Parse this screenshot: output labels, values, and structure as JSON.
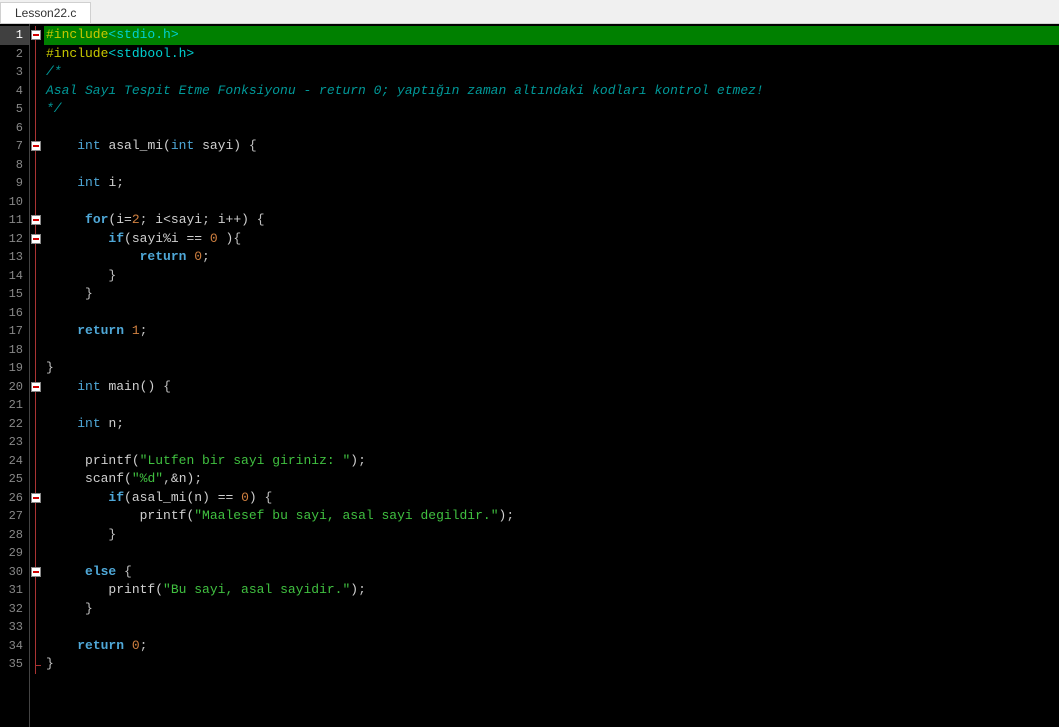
{
  "tab": {
    "title": "Lesson22.c"
  },
  "lines": [
    {
      "n": 1,
      "fold": "marker",
      "hl": true,
      "tokens": [
        [
          "preproc",
          "#include"
        ],
        [
          "include",
          "<stdio.h>"
        ]
      ]
    },
    {
      "n": 2,
      "fold": "line",
      "tokens": [
        [
          "preproc",
          "#include"
        ],
        [
          "include",
          "<stdbool.h>"
        ]
      ]
    },
    {
      "n": 3,
      "fold": "line",
      "tokens": [
        [
          "comment",
          "/*"
        ]
      ]
    },
    {
      "n": 4,
      "fold": "line",
      "tokens": [
        [
          "comment",
          "Asal Sayı Tespit Etme Fonksiyonu - return 0; yaptığın zaman altındaki kodları kontrol etmez!"
        ]
      ]
    },
    {
      "n": 5,
      "fold": "line",
      "tokens": [
        [
          "comment",
          "*/"
        ]
      ]
    },
    {
      "n": 6,
      "fold": "line",
      "tokens": []
    },
    {
      "n": 7,
      "fold": "marker",
      "tokens": [
        [
          "ident",
          "    "
        ],
        [
          "type",
          "int "
        ],
        [
          "func",
          "asal_mi"
        ],
        [
          "paren",
          "("
        ],
        [
          "type",
          "int "
        ],
        [
          "ident",
          "sayi"
        ],
        [
          "paren",
          ") "
        ],
        [
          "punct",
          "{"
        ]
      ]
    },
    {
      "n": 8,
      "fold": "line",
      "tokens": []
    },
    {
      "n": 9,
      "fold": "line",
      "tokens": [
        [
          "ident",
          "    "
        ],
        [
          "type",
          "int "
        ],
        [
          "ident",
          "i"
        ],
        [
          "punct",
          ";"
        ]
      ]
    },
    {
      "n": 10,
      "fold": "line",
      "tokens": []
    },
    {
      "n": 11,
      "fold": "marker",
      "tokens": [
        [
          "ident",
          "     "
        ],
        [
          "keyword",
          "for"
        ],
        [
          "paren",
          "("
        ],
        [
          "ident",
          "i"
        ],
        [
          "op",
          "="
        ],
        [
          "num",
          "2"
        ],
        [
          "punct",
          "; "
        ],
        [
          "ident",
          "i"
        ],
        [
          "op",
          "<"
        ],
        [
          "ident",
          "sayi"
        ],
        [
          "punct",
          "; "
        ],
        [
          "ident",
          "i"
        ],
        [
          "op",
          "++"
        ],
        [
          "paren",
          ") "
        ],
        [
          "punct",
          "{"
        ]
      ]
    },
    {
      "n": 12,
      "fold": "marker",
      "tokens": [
        [
          "ident",
          "        "
        ],
        [
          "keyword",
          "if"
        ],
        [
          "paren",
          "("
        ],
        [
          "ident",
          "sayi"
        ],
        [
          "op",
          "%"
        ],
        [
          "ident",
          "i "
        ],
        [
          "op",
          "== "
        ],
        [
          "num",
          "0 "
        ],
        [
          "paren",
          ")"
        ],
        [
          "punct",
          "{"
        ]
      ]
    },
    {
      "n": 13,
      "fold": "line",
      "tokens": [
        [
          "ident",
          "            "
        ],
        [
          "return",
          "return "
        ],
        [
          "num",
          "0"
        ],
        [
          "punct",
          ";"
        ]
      ]
    },
    {
      "n": 14,
      "fold": "line",
      "tokens": [
        [
          "ident",
          "        "
        ],
        [
          "punct",
          "}"
        ]
      ]
    },
    {
      "n": 15,
      "fold": "line",
      "tokens": [
        [
          "ident",
          "     "
        ],
        [
          "punct",
          "}"
        ]
      ]
    },
    {
      "n": 16,
      "fold": "line",
      "tokens": []
    },
    {
      "n": 17,
      "fold": "line",
      "tokens": [
        [
          "ident",
          "    "
        ],
        [
          "return",
          "return "
        ],
        [
          "num",
          "1"
        ],
        [
          "punct",
          ";"
        ]
      ]
    },
    {
      "n": 18,
      "fold": "line",
      "tokens": []
    },
    {
      "n": 19,
      "fold": "line",
      "tokens": [
        [
          "punct",
          "}"
        ]
      ]
    },
    {
      "n": 20,
      "fold": "marker",
      "tokens": [
        [
          "ident",
          "    "
        ],
        [
          "type",
          "int "
        ],
        [
          "func",
          "main"
        ],
        [
          "paren",
          "() "
        ],
        [
          "punct",
          "{"
        ]
      ]
    },
    {
      "n": 21,
      "fold": "line",
      "tokens": []
    },
    {
      "n": 22,
      "fold": "line",
      "tokens": [
        [
          "ident",
          "    "
        ],
        [
          "type",
          "int "
        ],
        [
          "ident",
          "n"
        ],
        [
          "punct",
          ";"
        ]
      ]
    },
    {
      "n": 23,
      "fold": "line",
      "tokens": []
    },
    {
      "n": 24,
      "fold": "line",
      "tokens": [
        [
          "ident",
          "     "
        ],
        [
          "func",
          "printf"
        ],
        [
          "paren",
          "("
        ],
        [
          "string",
          "\"Lutfen bir sayi giriniz: \""
        ],
        [
          "paren",
          ")"
        ],
        [
          "punct",
          ";"
        ]
      ]
    },
    {
      "n": 25,
      "fold": "line",
      "tokens": [
        [
          "ident",
          "     "
        ],
        [
          "func",
          "scanf"
        ],
        [
          "paren",
          "("
        ],
        [
          "string",
          "\"%d\""
        ],
        [
          "punct",
          ","
        ],
        [
          "op",
          "&"
        ],
        [
          "ident",
          "n"
        ],
        [
          "paren",
          ")"
        ],
        [
          "punct",
          ";"
        ]
      ]
    },
    {
      "n": 26,
      "fold": "marker",
      "tokens": [
        [
          "ident",
          "        "
        ],
        [
          "keyword",
          "if"
        ],
        [
          "paren",
          "("
        ],
        [
          "func",
          "asal_mi"
        ],
        [
          "paren",
          "("
        ],
        [
          "ident",
          "n"
        ],
        [
          "paren",
          ") "
        ],
        [
          "op",
          "== "
        ],
        [
          "num",
          "0"
        ],
        [
          "paren",
          ") "
        ],
        [
          "punct",
          "{"
        ]
      ]
    },
    {
      "n": 27,
      "fold": "line",
      "tokens": [
        [
          "ident",
          "            "
        ],
        [
          "func",
          "printf"
        ],
        [
          "paren",
          "("
        ],
        [
          "string",
          "\"Maalesef bu sayi, asal sayi degildir.\""
        ],
        [
          "paren",
          ")"
        ],
        [
          "punct",
          ";"
        ]
      ]
    },
    {
      "n": 28,
      "fold": "line",
      "tokens": [
        [
          "ident",
          "        "
        ],
        [
          "punct",
          "}"
        ]
      ]
    },
    {
      "n": 29,
      "fold": "line",
      "tokens": []
    },
    {
      "n": 30,
      "fold": "marker",
      "tokens": [
        [
          "ident",
          "     "
        ],
        [
          "keyword",
          "else "
        ],
        [
          "punct",
          "{"
        ]
      ]
    },
    {
      "n": 31,
      "fold": "line",
      "tokens": [
        [
          "ident",
          "        "
        ],
        [
          "func",
          "printf"
        ],
        [
          "paren",
          "("
        ],
        [
          "string",
          "\"Bu sayi, asal sayidir.\""
        ],
        [
          "paren",
          ")"
        ],
        [
          "punct",
          ";"
        ]
      ]
    },
    {
      "n": 32,
      "fold": "line",
      "tokens": [
        [
          "ident",
          "     "
        ],
        [
          "punct",
          "}"
        ]
      ]
    },
    {
      "n": 33,
      "fold": "line",
      "tokens": []
    },
    {
      "n": 34,
      "fold": "line",
      "tokens": [
        [
          "ident",
          "    "
        ],
        [
          "return",
          "return "
        ],
        [
          "num",
          "0"
        ],
        [
          "punct",
          ";"
        ]
      ]
    },
    {
      "n": 35,
      "fold": "end",
      "tokens": [
        [
          "punct",
          "}"
        ]
      ]
    }
  ]
}
